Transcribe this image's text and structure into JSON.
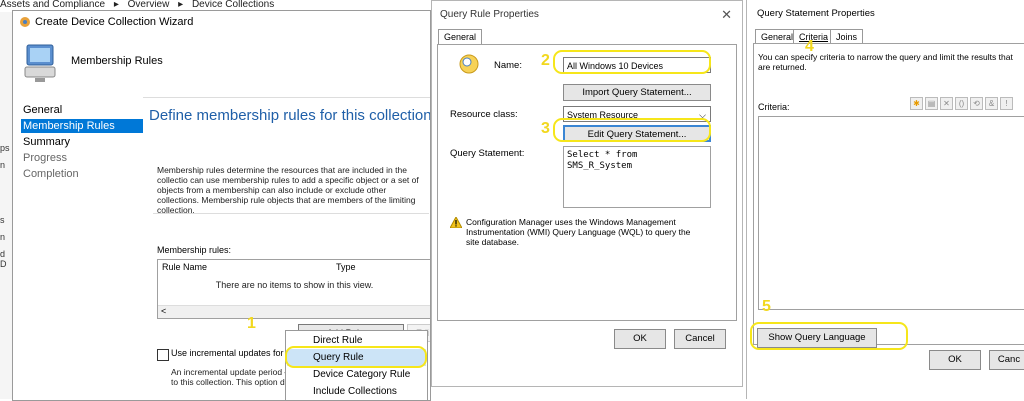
{
  "breadcrumb": {
    "items": [
      "Assets and Compliance",
      "Overview",
      "Device Collections"
    ],
    "separator": "▸"
  },
  "left_stub": {
    "items": [
      "ps",
      "n",
      "s",
      "n",
      "d D"
    ]
  },
  "wizard": {
    "title": "Create Device Collection Wizard",
    "header": "Membership Rules",
    "nav": [
      {
        "label": "General"
      },
      {
        "label": "Membership Rules"
      },
      {
        "label": "Summary"
      },
      {
        "label": "Progress"
      },
      {
        "label": "Completion"
      }
    ],
    "heading": "Define membership rules for this collection",
    "description": "Membership rules determine the resources that are included in the collectio can use membership rules to add a specific object or a set of objects from a membership can also include or exclude other collections. Membership rule objects that are members of the limiting collection.",
    "membership_label": "Membership rules:",
    "columns": [
      "Rule Name",
      "Type"
    ],
    "empty_message": "There are no items to show in this view.",
    "add_rule": "Add Rule",
    "edit": "Edi",
    "incremental_label": "Use incremental updates for this",
    "incremental_text": "An incremental update period — to this collection. This option do",
    "dropdown": [
      "Direct Rule",
      "Query Rule",
      "Device Category Rule",
      "Include Collections"
    ]
  },
  "query_rule": {
    "title": "Query Rule Properties",
    "tab": "General",
    "name_label": "Name:",
    "name_value": "All Windows 10 Devices",
    "import_button": "Import Query Statement...",
    "resource_label": "Resource class:",
    "resource_value": "System Resource",
    "edit_button": "Edit Query Statement...",
    "query_label": "Query Statement:",
    "query_value": "Select * from\nSMS_R_System",
    "warning": "Configuration Manager uses the Windows Management Instrumentation (WMI) Query Language (WQL) to query the site database.",
    "ok": "OK",
    "cancel": "Cancel"
  },
  "query_statement": {
    "title": "Query Statement Properties",
    "tabs": [
      "General",
      "Criteria",
      "Joins"
    ],
    "description": "You can specify criteria to narrow the query and limit the results that are returned.",
    "criteria_label": "Criteria:",
    "show_query_button": "Show Query Language",
    "ok": "OK",
    "cancel": "Canc"
  },
  "annotations": [
    "1",
    "2",
    "3",
    "4",
    "5"
  ],
  "colors": {
    "highlight": "#f6e61a",
    "selection": "#0078d7",
    "heading": "#1f5fa8",
    "dropdown_selected": "#cce4f7"
  }
}
